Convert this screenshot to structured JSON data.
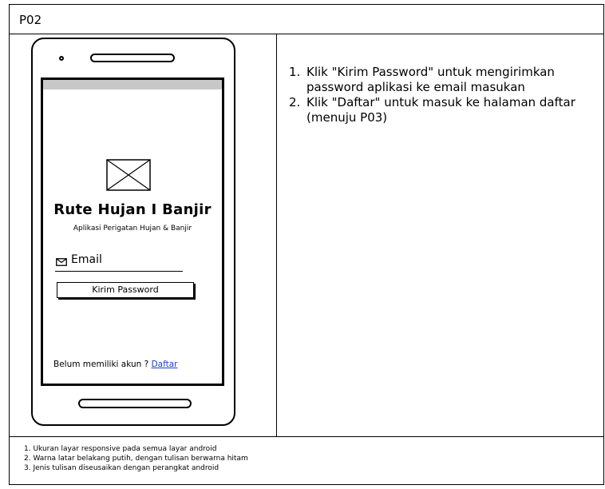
{
  "header": {
    "title": "P02"
  },
  "phone": {
    "app_title": "Rute Hujan I Banjir",
    "app_subtitle": "Aplikasi Perigatan Hujan & Banjir",
    "email_label": "Email",
    "send_button": "Kirim Password",
    "footer_text": "Belum memiliki akun ? ",
    "signup_link": "Daftar",
    "icons": [
      "image-placeholder-icon",
      "mail-icon"
    ]
  },
  "instructions": [
    {
      "num": "1.",
      "text": "Klik \"Kirim Password\" untuk mengirimkan password aplikasi ke email masukan"
    },
    {
      "num": "2.",
      "text": "Klik \"Daftar\" untuk masuk ke halaman daftar (menuju P03)"
    }
  ],
  "notes": [
    "1. Ukuran layar responsive pada semua layar android",
    "2. Warna latar belakang putih, dengan tulisan berwarna hitam",
    "3. Jenis tulisan diseusaikan dengan perangkat android"
  ]
}
